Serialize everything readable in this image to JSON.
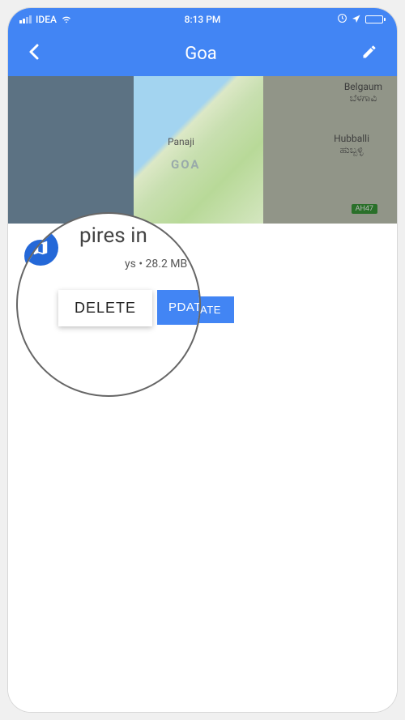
{
  "status": {
    "carrier": "IDEA",
    "time": "8:13 PM"
  },
  "nav": {
    "title": "Goa"
  },
  "map": {
    "city_belgaum": "Belgaum",
    "city_belgaum_native": "ಬೆಳಗಾವಿ",
    "city_panaji": "Panaji",
    "region_goa": "GOA",
    "city_hubballi": "Hubballi",
    "city_hubballi_native": "ಹುಬ್ಬಳ್ಳಿ",
    "highway": "AH47"
  },
  "detail": {
    "heading_partial": "pires in",
    "info_partial": "ys • 28.2 MB",
    "update_partial_label": "PDATE",
    "delete_label": "DELETE"
  },
  "colors": {
    "primary": "#4285f4",
    "badge": "#2468d8"
  }
}
